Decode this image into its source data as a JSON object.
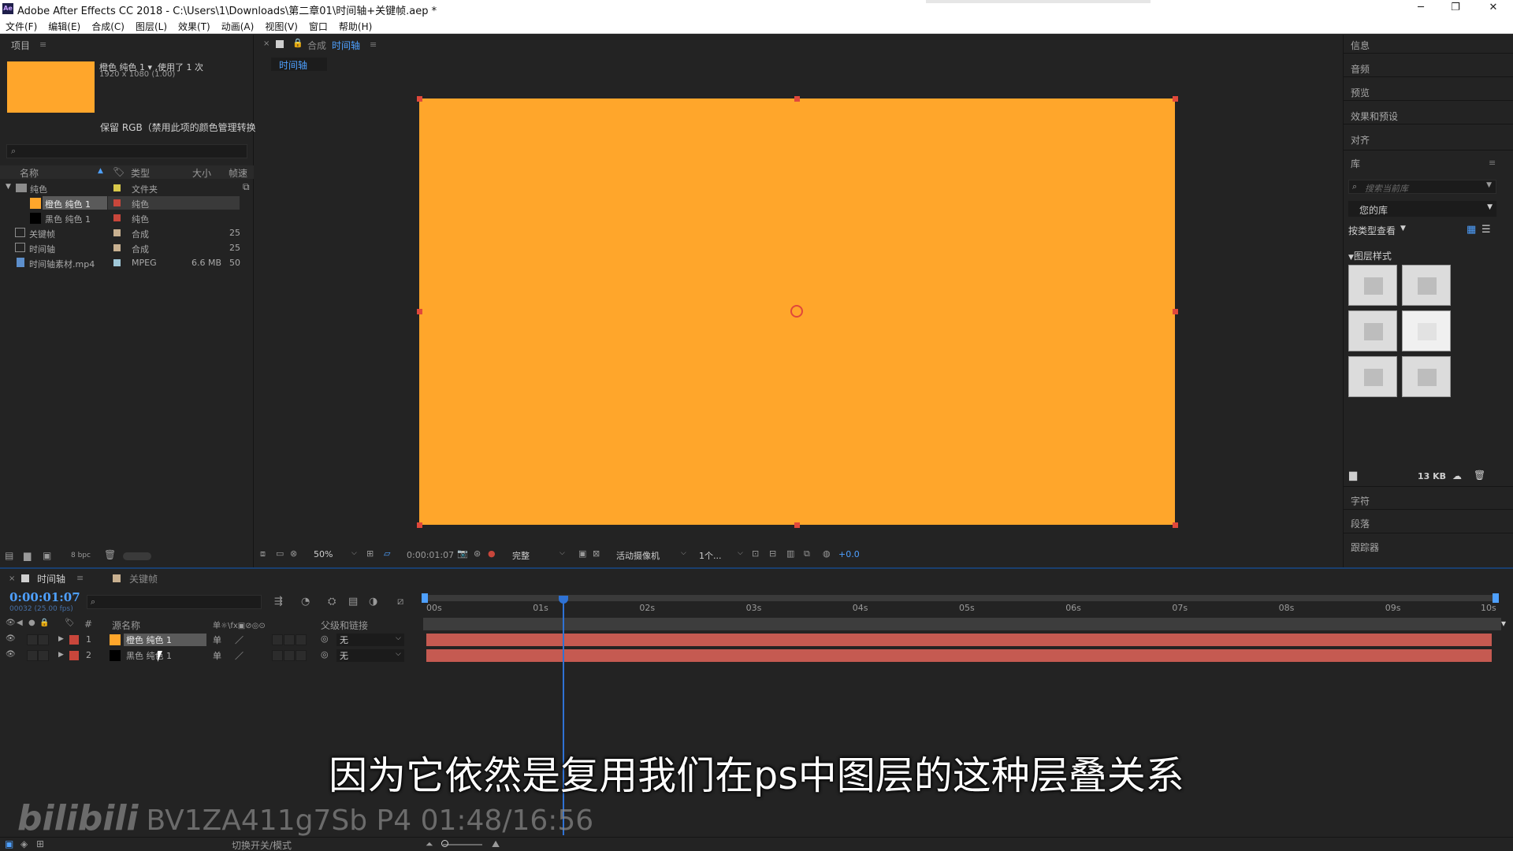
{
  "window": {
    "title": "Adobe After Effects CC 2018 - C:\\Users\\1\\Downloads\\第二章01\\时间轴+关键帧.aep *",
    "min": "─",
    "max": "❐",
    "close": "✕"
  },
  "menu": [
    "文件(F)",
    "编辑(E)",
    "合成(C)",
    "图层(L)",
    "效果(T)",
    "动画(A)",
    "视图(V)",
    "窗口",
    "帮助(H)"
  ],
  "project": {
    "title": "项目",
    "item_name": "橙色 纯色 1 ▾ ,使用了 1 次",
    "item_dims": "1920 x 1080 (1.00)",
    "preserve_rgb": "保留 RGB（禁用此项的颜色管理转换",
    "columns": {
      "name": "名称",
      "type": "类型",
      "size": "大小",
      "fps": "帧速"
    },
    "rows": [
      {
        "name": "纯色",
        "type": "文件夹",
        "size": "",
        "fps": "",
        "label": "#d8c84a"
      },
      {
        "name": "橙色 纯色 1",
        "type": "纯色",
        "size": "",
        "fps": "",
        "label": "#c8463b",
        "swatch": "#ffa62b"
      },
      {
        "name": "黑色 纯色 1",
        "type": "纯色",
        "size": "",
        "fps": "",
        "label": "#c8463b",
        "swatch": "#000000"
      },
      {
        "name": "关键帧",
        "type": "合成",
        "size": "",
        "fps": "25",
        "label": "#c8b090"
      },
      {
        "name": "时间轴",
        "type": "合成",
        "size": "",
        "fps": "25",
        "label": "#c8b090"
      },
      {
        "name": "时间轴素材.mp4",
        "type": "MPEG",
        "size": "6.6 MB",
        "fps": "50",
        "label": "#a0c8d8"
      }
    ],
    "bpc": "8 bpc"
  },
  "comp": {
    "tab_label": "合成",
    "tab_name": "时间轴",
    "flow_tab": "时间轴",
    "canvas_color": "#ffa62b",
    "zoom": "50%",
    "timecode": "0:00:01:07",
    "resolution": "完整",
    "camera": "活动摄像机",
    "views": "1个...",
    "exposure": "+0.0"
  },
  "right": {
    "info": "信息",
    "audio": "音频",
    "preview": "预览",
    "effects": "效果和预设",
    "align": "对齐",
    "library": "库",
    "search_placeholder": "搜索当前库",
    "your_library": "您的库",
    "view_by_type": "按类型查看",
    "layer_styles": "图层样式",
    "size": "13 KB",
    "character": "字符",
    "paragraph": "段落",
    "tracker": "跟踪器"
  },
  "timeline": {
    "tab_active": "时间轴",
    "tab_other": "关键帧",
    "time": "0:00:01:07",
    "fps_note": "00032 (25.00 fps)",
    "col_num": "#",
    "col_source": "源名称",
    "col_switches": "单☼\\fx▣⊘◎⊙",
    "col_parent": "父级和链接",
    "ticks": [
      "00s",
      "01s",
      "02s",
      "03s",
      "04s",
      "05s",
      "06s",
      "07s",
      "08s",
      "09s",
      "10s"
    ],
    "playhead_seconds": 1.28,
    "layers": [
      {
        "num": "1",
        "name": "橙色 纯色 1",
        "label": "#c8463b",
        "swatch": "#ffa62b",
        "parent": "无",
        "switch": "单"
      },
      {
        "num": "2",
        "name": "黑色 纯色 1",
        "label": "#c8463b",
        "swatch": "#000000",
        "parent": "无",
        "switch": "单"
      }
    ],
    "toggle_label": "切换开关/模式"
  },
  "subtitle": "因为它依然是复用我们在ps中图层的这种层叠关系",
  "watermark": {
    "logo": "bilibili",
    "text": "BV1ZA411g7Sb P4 01:48/16:56"
  }
}
